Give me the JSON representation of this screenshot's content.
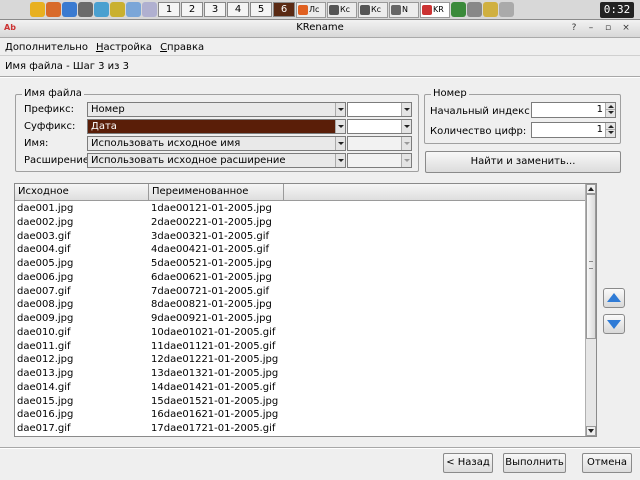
{
  "taskbar": {
    "desktops": [
      "1",
      "2",
      "3",
      "4",
      "5",
      "6"
    ],
    "tasks": [
      "Лс",
      "Кс",
      "Кс",
      "N",
      "KR"
    ],
    "clock": "0:32",
    "colors": {
      "active_desktop": "#5a2a14"
    }
  },
  "window": {
    "title": "KRename",
    "help_glyph": "?",
    "minimize_glyph": "–",
    "maximize_glyph": "▫",
    "close_glyph": "×",
    "app_icon": "Ab"
  },
  "menu": [
    "Дополнительно",
    "Настройка",
    "Справка"
  ],
  "step_title": "Имя файла - Шаг 3 из 3",
  "filename_group": {
    "title": "Имя файла",
    "rows": [
      {
        "label": "Префикс:",
        "value": "Номер",
        "extra": ""
      },
      {
        "label": "Суффикс:",
        "value": "Дата",
        "extra": ""
      },
      {
        "label": "Имя:",
        "value": "Использовать исходное имя",
        "extra": ""
      },
      {
        "label": "Расширение:",
        "value": "Использовать исходное расширение",
        "extra": ""
      }
    ]
  },
  "number_group": {
    "title": "Номер",
    "start_label": "Начальный индекс",
    "start_value": "1",
    "digits_label": "Количество цифр:",
    "digits_value": "1"
  },
  "find_replace_label": "Найти и заменить...",
  "list": {
    "headers": [
      "Исходное",
      "Переименованное"
    ],
    "rows": [
      [
        "dae001.jpg",
        "1dae00121-01-2005.jpg"
      ],
      [
        "dae002.jpg",
        "2dae00221-01-2005.jpg"
      ],
      [
        "dae003.gif",
        "3dae00321-01-2005.gif"
      ],
      [
        "dae004.gif",
        "4dae00421-01-2005.gif"
      ],
      [
        "dae005.jpg",
        "5dae00521-01-2005.jpg"
      ],
      [
        "dae006.jpg",
        "6dae00621-01-2005.jpg"
      ],
      [
        "dae007.gif",
        "7dae00721-01-2005.gif"
      ],
      [
        "dae008.jpg",
        "8dae00821-01-2005.jpg"
      ],
      [
        "dae009.jpg",
        "9dae00921-01-2005.jpg"
      ],
      [
        "dae010.gif",
        "10dae01021-01-2005.gif"
      ],
      [
        "dae011.gif",
        "11dae01121-01-2005.gif"
      ],
      [
        "dae012.jpg",
        "12dae01221-01-2005.jpg"
      ],
      [
        "dae013.jpg",
        "13dae01321-01-2005.jpg"
      ],
      [
        "dae014.gif",
        "14dae01421-01-2005.gif"
      ],
      [
        "dae015.jpg",
        "15dae01521-01-2005.jpg"
      ],
      [
        "dae016.jpg",
        "16dae01621-01-2005.jpg"
      ],
      [
        "dae017.gif",
        "17dae01721-01-2005.gif"
      ]
    ]
  },
  "buttons": {
    "back": "< Назад",
    "execute": "Выполнить",
    "cancel": "Отмена"
  },
  "colors": {
    "selection": "#5a1e08",
    "arrow_blue": "#2f7bd6"
  }
}
